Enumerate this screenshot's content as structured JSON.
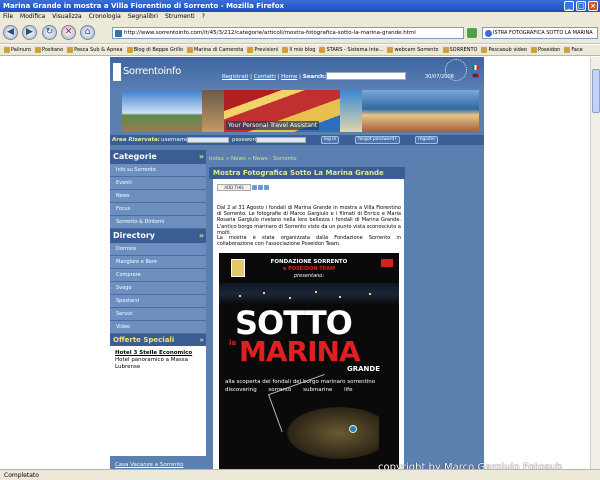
{
  "window": {
    "title": "Marina Grande in mostra a Villa Fiorentino di Sorrento - Mozilla Firefox"
  },
  "menu": [
    "File",
    "Modifica",
    "Visualizza",
    "Cronologia",
    "Segnalibri",
    "Strumenti",
    "?"
  ],
  "nav": {
    "url": "http://www.sorrentoinfo.com/it/45/3/212/categorie/articoli/mostra-fotografica-sotto-la-marina-grande.html",
    "search_value": "ISTRA FOTOGRAFICA SOTTO LA MARINA"
  },
  "bookmarks": [
    "Palinuro",
    "Positano",
    "Pesca Sub & Apnea",
    "Blog di Beppe Grillo",
    "Marina di Camerota",
    "Previsioni",
    "Il mio blog",
    "STARS - Sistema inte...",
    "webcam Sorrento",
    "SORRENTO",
    "Pescasub video",
    "Poseidon",
    "Face"
  ],
  "site": {
    "logo": "Sorrentoinfo",
    "topnav": [
      "Registrati",
      "Contatti",
      "Home"
    ],
    "search_label": "Search:",
    "date": "30/07/2008",
    "banner_tag": "Your Personal Travel Assistant",
    "login_label": "Area Riservata:",
    "username_label": "username",
    "password_label": "password",
    "login_btn": "log in",
    "forgot_btn": "forgot password?",
    "register_btn": "register"
  },
  "sidebar": {
    "categorie_title": "Categorie",
    "categorie": [
      "Info su Sorrento",
      "Eventi",
      "News",
      "Focus",
      "Sorrento & Dintorni"
    ],
    "directory_title": "Directory",
    "directory": [
      "Dormire",
      "Mangiare e Bere",
      "Comprare",
      "Svago",
      "Spostarsi",
      "Servizi",
      "Video"
    ],
    "offerte_title": "Offerte Speciali",
    "offerta_name": "Hotel 3 Stelle Economico",
    "offerta_desc": "Hotel panoramico a Massa Lubrense",
    "offerta_footer": "Casa Vacanze a Sorrento"
  },
  "main": {
    "breadcrumb": "Index » News » News - Sorrento",
    "title": "Mostra Fotografica Sotto La Marina Grande",
    "addthis": "ADD THIS",
    "para1": "Dal 2 al 31 Agosto i fondali di Marina Grande in mostra a Villa Fiorentino di Sorrento. Le fotografie di Marco Gargiulo e i filmati di Enrico e Maria Rosaria Gargiulo rivelano nella loro bellezza i fondali di Marina Grande. L'antico borgo marinaro di Sorrento visto da un punto vista sconosciuto a molti.",
    "para2": "La mostra è stata organizzata dalla Fondazione Sorrento in collaborazione con l'associazione Poseidon Team."
  },
  "poster": {
    "line1": "FONDAZIONE SORRENTO",
    "line2": "e POSEIDON TEAM",
    "line3": "presentano:",
    "sotto": "SOTTO",
    "la": "la",
    "marina": "MARINA",
    "grande": "GRANDE",
    "sub1": "alla scoperta dei fondali del borgo marinaro sorrentino",
    "sub2": "discovering sorrento submarine life"
  },
  "watermark": "copyright by Marco Gargiulo Fotosub",
  "status": "Completato"
}
